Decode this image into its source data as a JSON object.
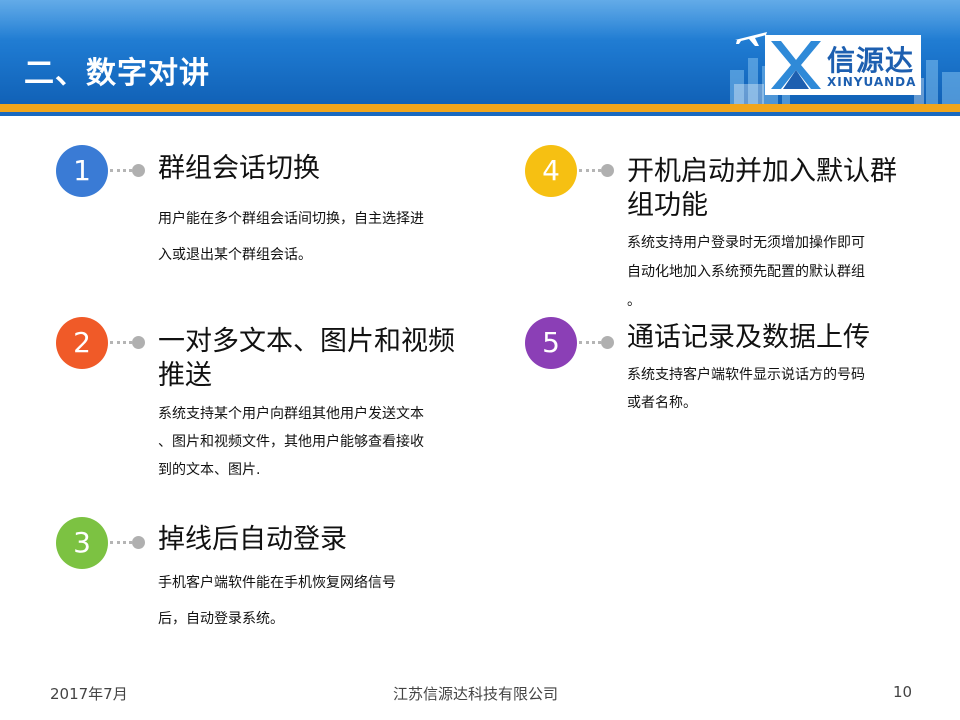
{
  "header": {
    "title": "二、数字对讲",
    "logo_cn": "信源达",
    "logo_en": "XINYUANDA"
  },
  "colors": {
    "header_blue": "#1d78cf",
    "header_stripe": "#f1a51b",
    "item1": "#3a7bd5",
    "item2": "#f05a28",
    "item3": "#7cc242",
    "item4": "#f6c012",
    "item5": "#8b3fb6"
  },
  "items": [
    {
      "number": "1",
      "title_lines": [
        "群组会话切换"
      ],
      "desc_lines": [
        "用户能在多个群组会话间切换，自主选择进",
        "入或退出某个群组会话。"
      ]
    },
    {
      "number": "2",
      "title_lines": [
        "一对多文本、图片和视频",
        "推送"
      ],
      "desc_lines": [
        "系统支持某个用户向群组其他用户发送文本",
        "、图片和视频文件，其他用户能够查看接收",
        "到的文本、图片."
      ]
    },
    {
      "number": "3",
      "title_lines": [
        "掉线后自动登录"
      ],
      "desc_lines": [
        "手机客户端软件能在手机恢复网络信号",
        "后，自动登录系统。"
      ]
    },
    {
      "number": "4",
      "title_lines": [
        "开机启动并加入默认群",
        "组功能"
      ],
      "desc_lines": [
        "系统支持用户登录时无须增加操作即可",
        "自动化地加入系统预先配置的默认群组",
        "。"
      ]
    },
    {
      "number": "5",
      "title_lines": [
        "通话记录及数据上传"
      ],
      "desc_lines": [
        "系统支持客户端软件显示说话方的号码",
        "或者名称。"
      ]
    }
  ],
  "footer": {
    "date": "2017年7月",
    "company": "江苏信源达科技有限公司",
    "page": "10"
  }
}
